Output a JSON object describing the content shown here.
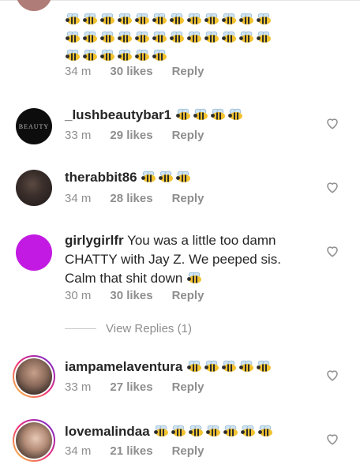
{
  "comments": [
    {
      "username": "",
      "text": "",
      "time": "34 m",
      "likes": "30 likes",
      "reply": "Reply",
      "bees": 30
    },
    {
      "username": "_lushbeautybar1",
      "text": "",
      "time": "33 m",
      "likes": "29 likes",
      "reply": "Reply",
      "bees": 4
    },
    {
      "username": "therabbit86",
      "text": "",
      "time": "34 m",
      "likes": "28 likes",
      "reply": "Reply",
      "bees": 3
    },
    {
      "username": "girlygirlfr",
      "text": "You was a little too damn CHATTY with Jay Z. We peeped sis. Calm that shit down",
      "time": "30 m",
      "likes": "30 likes",
      "reply": "Reply",
      "bees": 1
    },
    {
      "username": "iampamelaventura",
      "text": "",
      "time": "33 m",
      "likes": "27 likes",
      "reply": "Reply",
      "bees": 5
    },
    {
      "username": "lovemalindaa",
      "text": "",
      "time": "34 m",
      "likes": "21 likes",
      "reply": "Reply",
      "bees": 7
    }
  ],
  "view_replies": "View Replies (1)",
  "colors": {
    "purple_avatar": "#c21ae3",
    "meta_gray": "#8e8e8e"
  }
}
